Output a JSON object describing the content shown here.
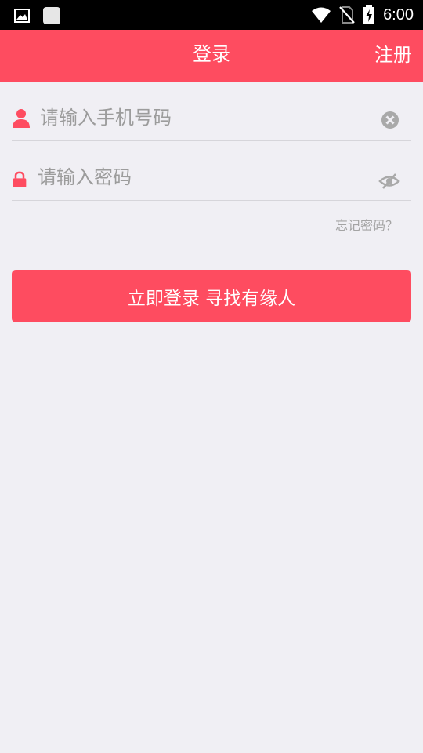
{
  "status_bar": {
    "time": "6:00",
    "icons": [
      "image-icon",
      "app-icon",
      "wifi-icon",
      "no-sim-icon",
      "battery-charging-icon"
    ]
  },
  "header": {
    "title": "登录",
    "register_label": "注册",
    "background_color": "#fe4c60"
  },
  "form": {
    "phone": {
      "placeholder": "请输入手机号码",
      "value": ""
    },
    "password": {
      "placeholder": "请输入密码",
      "value": ""
    },
    "forgot_label": "忘记密码？",
    "login_label": "立即登录 寻找有缘人"
  },
  "colors": {
    "accent": "#fe4c60",
    "background": "#f0eff4",
    "placeholder": "#9c9c9c"
  }
}
